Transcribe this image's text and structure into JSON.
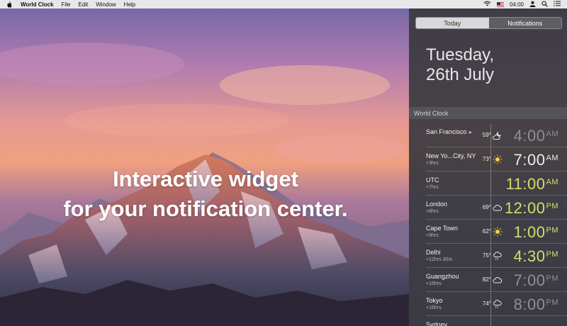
{
  "menubar": {
    "app_name": "World Clock",
    "items": [
      "File",
      "Edit",
      "Window",
      "Help"
    ],
    "clock": "04:00"
  },
  "hero": {
    "line1": "Interactive widget",
    "line2": "for your notification center."
  },
  "panel": {
    "tabs": [
      {
        "label": "Today",
        "active": true
      },
      {
        "label": "Notifications",
        "active": false
      }
    ],
    "date_line1": "Tuesday,",
    "date_line2": "26th July",
    "section_title": "World Clock",
    "rows": [
      {
        "city": "San Francisco",
        "arrow": "➤",
        "offset": "",
        "temp": "59°",
        "icon": "partly-cloudy-night-icon",
        "time": "4:00",
        "ampm": "AM",
        "tone": "night"
      },
      {
        "city": "New Yo...City, NY",
        "arrow": "",
        "offset": "+3hrs",
        "temp": "73°",
        "icon": "sun-icon",
        "time": "7:00",
        "ampm": "AM",
        "tone": "am"
      },
      {
        "city": "UTC",
        "arrow": "",
        "offset": "+7hrs",
        "temp": "",
        "icon": "",
        "time": "11:00",
        "ampm": "AM",
        "tone": "day-light"
      },
      {
        "city": "London",
        "arrow": "",
        "offset": "+8hrs",
        "temp": "69°",
        "icon": "cloud-icon",
        "time": "12:00",
        "ampm": "PM",
        "tone": "day-light"
      },
      {
        "city": "Cape Town",
        "arrow": "",
        "offset": "+9hrs",
        "temp": "62°",
        "icon": "sun-icon",
        "time": "1:00",
        "ampm": "PM",
        "tone": "day-light"
      },
      {
        "city": "Delhi",
        "arrow": "",
        "offset": "+12hrs 30m",
        "temp": "75°",
        "icon": "rain-cloud-icon",
        "time": "4:30",
        "ampm": "PM",
        "tone": "day-light"
      },
      {
        "city": "Guangzhou",
        "arrow": "",
        "offset": "+15hrs",
        "temp": "82°",
        "icon": "cloud-icon",
        "time": "7:00",
        "ampm": "PM",
        "tone": "night"
      },
      {
        "city": "Tokyo",
        "arrow": "",
        "offset": "+16hrs",
        "temp": "74°",
        "icon": "rain-cloud-icon",
        "time": "8:00",
        "ampm": "PM",
        "tone": "night"
      },
      {
        "city": "Sydney",
        "arrow": "",
        "offset": "",
        "temp": "",
        "icon": "",
        "time": "",
        "ampm": "",
        "tone": "night"
      }
    ]
  }
}
